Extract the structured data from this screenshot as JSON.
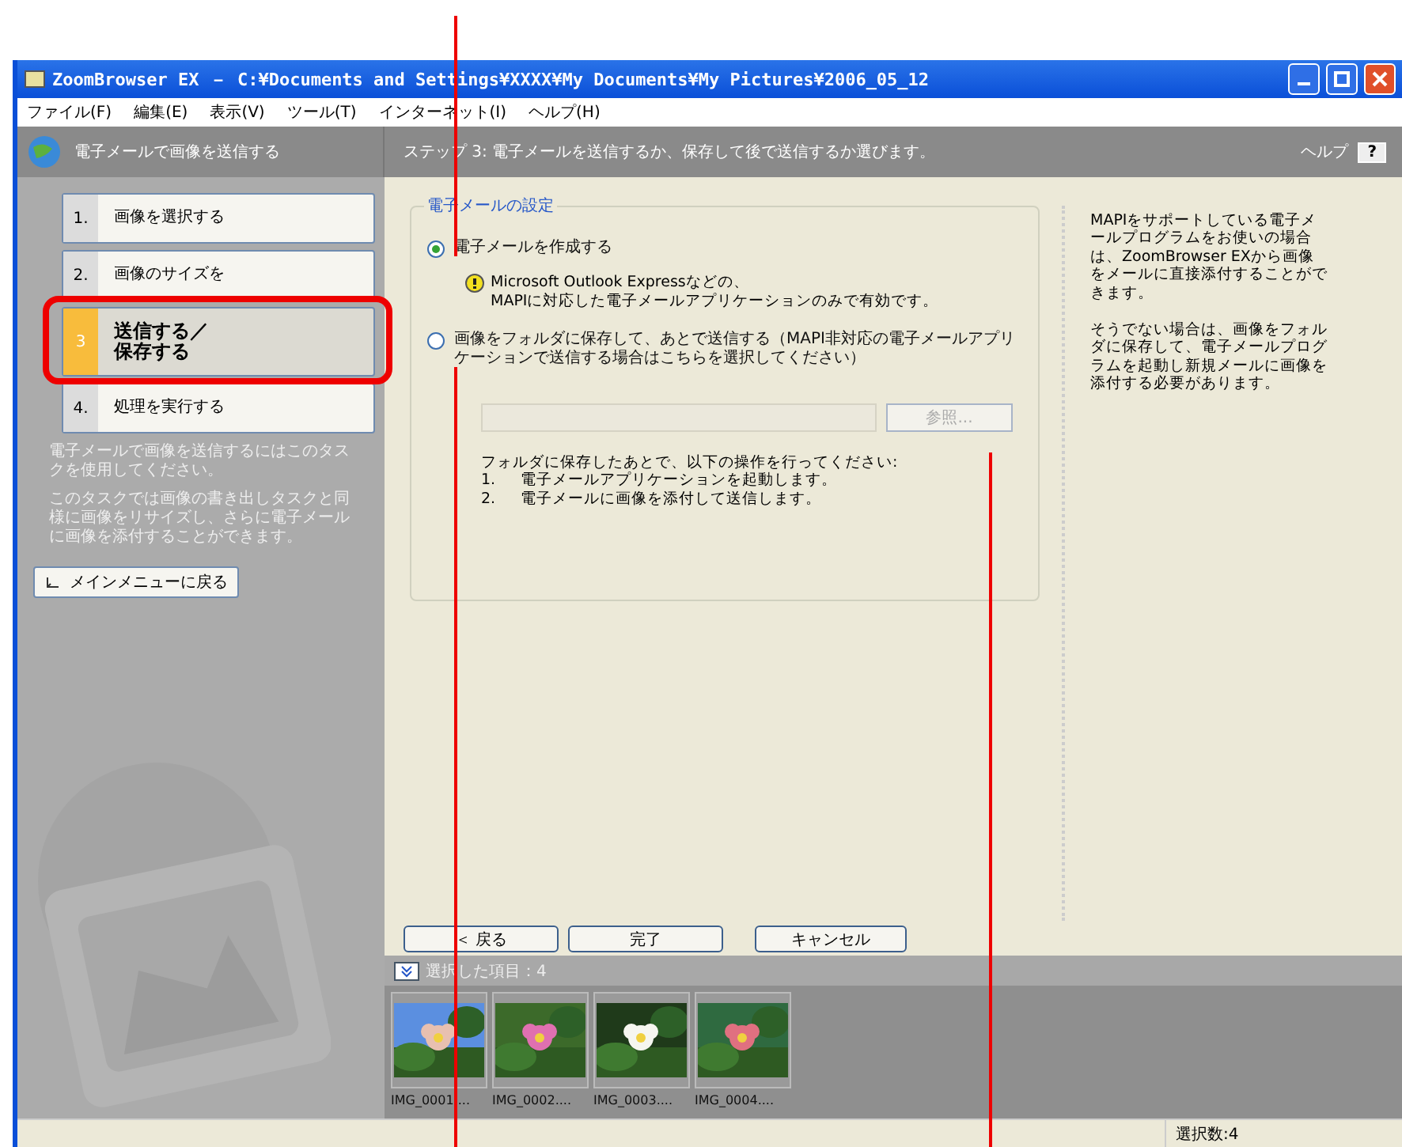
{
  "window": {
    "title": "ZoomBrowser EX  －  C:¥Documents and Settings¥XXXX¥My Documents¥My Pictures¥2006_05_12"
  },
  "menu": [
    "ファイル(F)",
    "編集(E)",
    "表示(V)",
    "ツール(T)",
    "インターネット(I)",
    "ヘルプ(H)"
  ],
  "header": {
    "task": "電子メールで画像を送信する",
    "step": "ステップ 3: 電子メールを送信するか、保存して後で送信するか選びます。",
    "help": "ヘルプ",
    "help_key": "?"
  },
  "steps": [
    {
      "number": "1.",
      "label": "画像を選択する",
      "selected": false
    },
    {
      "number": "2.",
      "label": "画像のサイズを",
      "selected": false
    },
    {
      "number": "3",
      "label": "送信する／保存する",
      "selected": true
    },
    {
      "number": "4.",
      "label": "処理を実行する",
      "selected": false
    }
  ],
  "sidebar_notes": [
    "電子メールで画像を送信するにはこのタスクを使用してください。",
    "このタスクでは画像の書き出しタスクと同様に画像をリサイズし、さらに電子メールに画像を添付することができます。"
  ],
  "back_to_menu": "メインメニューに戻る",
  "settings": {
    "legend": "電子メールの設定",
    "options": [
      {
        "label": "電子メールを作成する",
        "selected": true,
        "note": "Microsoft Outlook Expressなどの、\nMAPIに対応した電子メールアプリケーションのみで有効です。"
      },
      {
        "label": "画像をフォルダに保存して、あとで送信する（MAPI非対応の電子メールアプリケーションで送信する場合はこちらを選択してください）",
        "selected": false
      }
    ],
    "browse": {
      "label": "参照...",
      "disabled": true
    },
    "instructions": "フォルダに保存したあとで、以下の操作を行ってください:",
    "instruction_steps": [
      {
        "number": "1.",
        "text": "電子メールアプリケーションを起動します。"
      },
      {
        "number": "2.",
        "text": "電子メールに画像を添付して送信します。"
      }
    ]
  },
  "help_text": [
    "MAPIをサポートしている電子メールプログラムをお使いの場合は、ZoomBrowser EXから画像をメールに直接添付することができます。",
    "そうでない場合は、画像をフォルダに保存して、電子メールプログラムを起動し新規メールに画像を添付する必要があります。"
  ],
  "buttons": [
    "＜ 戻る",
    "完了",
    "キャンセル"
  ],
  "selected_bar": {
    "label": "選択した項目：4"
  },
  "thumbnails": [
    {
      "caption": "IMG_0001....",
      "kind": "picture"
    },
    {
      "caption": "IMG_0002....",
      "kind": "picture"
    },
    {
      "caption": "IMG_0003....",
      "kind": "picture"
    },
    {
      "caption": "IMG_0004....",
      "kind": "picture"
    }
  ],
  "status_bar": {
    "count": "選択数:4"
  }
}
